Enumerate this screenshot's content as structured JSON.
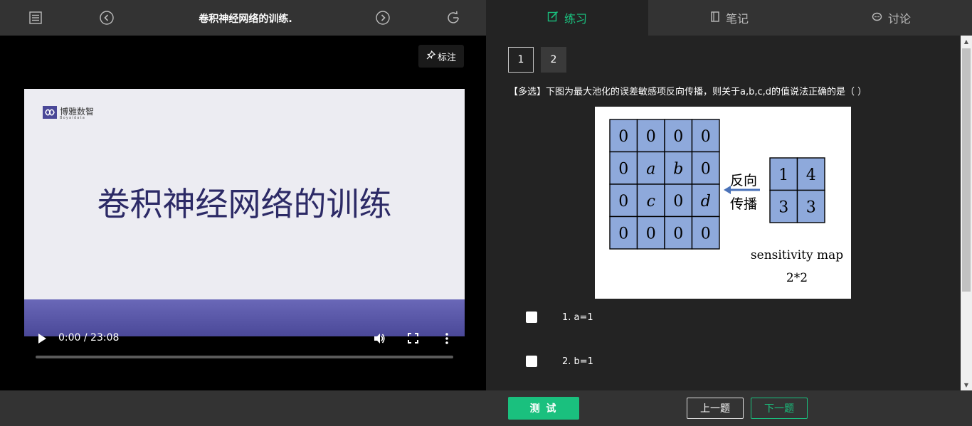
{
  "header": {
    "title": "卷积神经网络的训练.",
    "icons": [
      "list-icon",
      "chevron-left-circle-icon",
      "chevron-right-circle-icon",
      "refresh-icon"
    ]
  },
  "video": {
    "mark_label": "标注",
    "slide": {
      "logo_text": "博雅数智",
      "logo_sub": "Boyaidata",
      "title": "卷积神经网络的训练"
    },
    "time": "0:00 / 23:08",
    "progress_fraction": 0
  },
  "tabs": [
    {
      "label": "练习",
      "icon": "edit-icon",
      "active": true
    },
    {
      "label": "笔记",
      "icon": "notebook-icon",
      "active": false
    },
    {
      "label": "讨论",
      "icon": "chat-icon",
      "active": false
    }
  ],
  "question_numbers": [
    "1",
    "2"
  ],
  "question": {
    "text": "【多选】下图为最大池化的误差敏感项反向传播，则关于a,b,c,d的值说法正确的是（ ）",
    "figure": {
      "grid": [
        [
          "0",
          "0",
          "0",
          "0"
        ],
        [
          "0",
          "a",
          "b",
          "0"
        ],
        [
          "0",
          "c",
          "0",
          "d"
        ],
        [
          "0",
          "0",
          "0",
          "0"
        ]
      ],
      "arrow_label_1": "反向",
      "arrow_label_2": "传播",
      "small_grid": [
        [
          "1",
          "4"
        ],
        [
          "3",
          "3"
        ]
      ],
      "caption_1": "sensitivity map",
      "caption_2": "2*2"
    },
    "options": [
      "1. a=1",
      "2. b=1"
    ]
  },
  "footer": {
    "test_label": "测 试",
    "prev_label": "上一题",
    "next_label": "下一题"
  },
  "colors": {
    "accent": "#1ac07e",
    "cell_fill": "#8ea9db",
    "slide_title": "#2c2a66"
  }
}
